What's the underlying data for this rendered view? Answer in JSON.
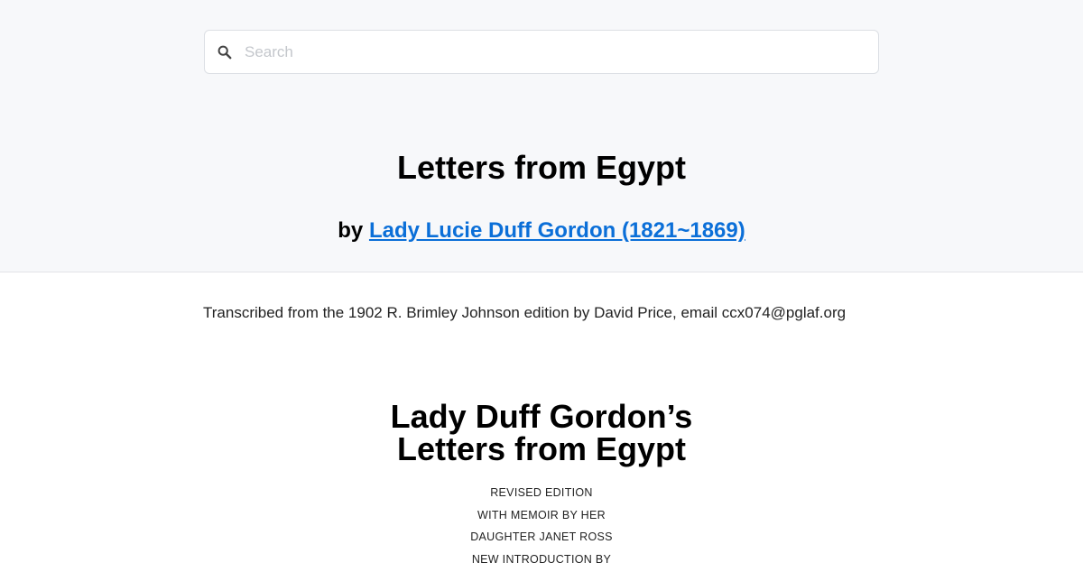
{
  "search": {
    "placeholder": "Search",
    "icon": "search-icon"
  },
  "book": {
    "title": "Letters from Egypt",
    "by_prefix": "by",
    "author_link": "Lady Lucie Duff Gordon (1821~1869)"
  },
  "transcription_note": "Transcribed from the 1902 R. Brimley Johnson edition by David Price, email ccx074@pglaf.org",
  "title_page": {
    "title_line_1": "Lady Duff Gordon’s",
    "title_line_2": "Letters from Egypt",
    "edition_lines": [
      "REVISED EDITION",
      "WITH MEMOIR BY HER",
      "DAUGHTER JANET ROSS",
      "NEW INTRODUCTION BY"
    ]
  },
  "colors": {
    "link": "#0b6fd8",
    "hero_background": "#f7f8fa",
    "placeholder": "#c4c7cc"
  }
}
